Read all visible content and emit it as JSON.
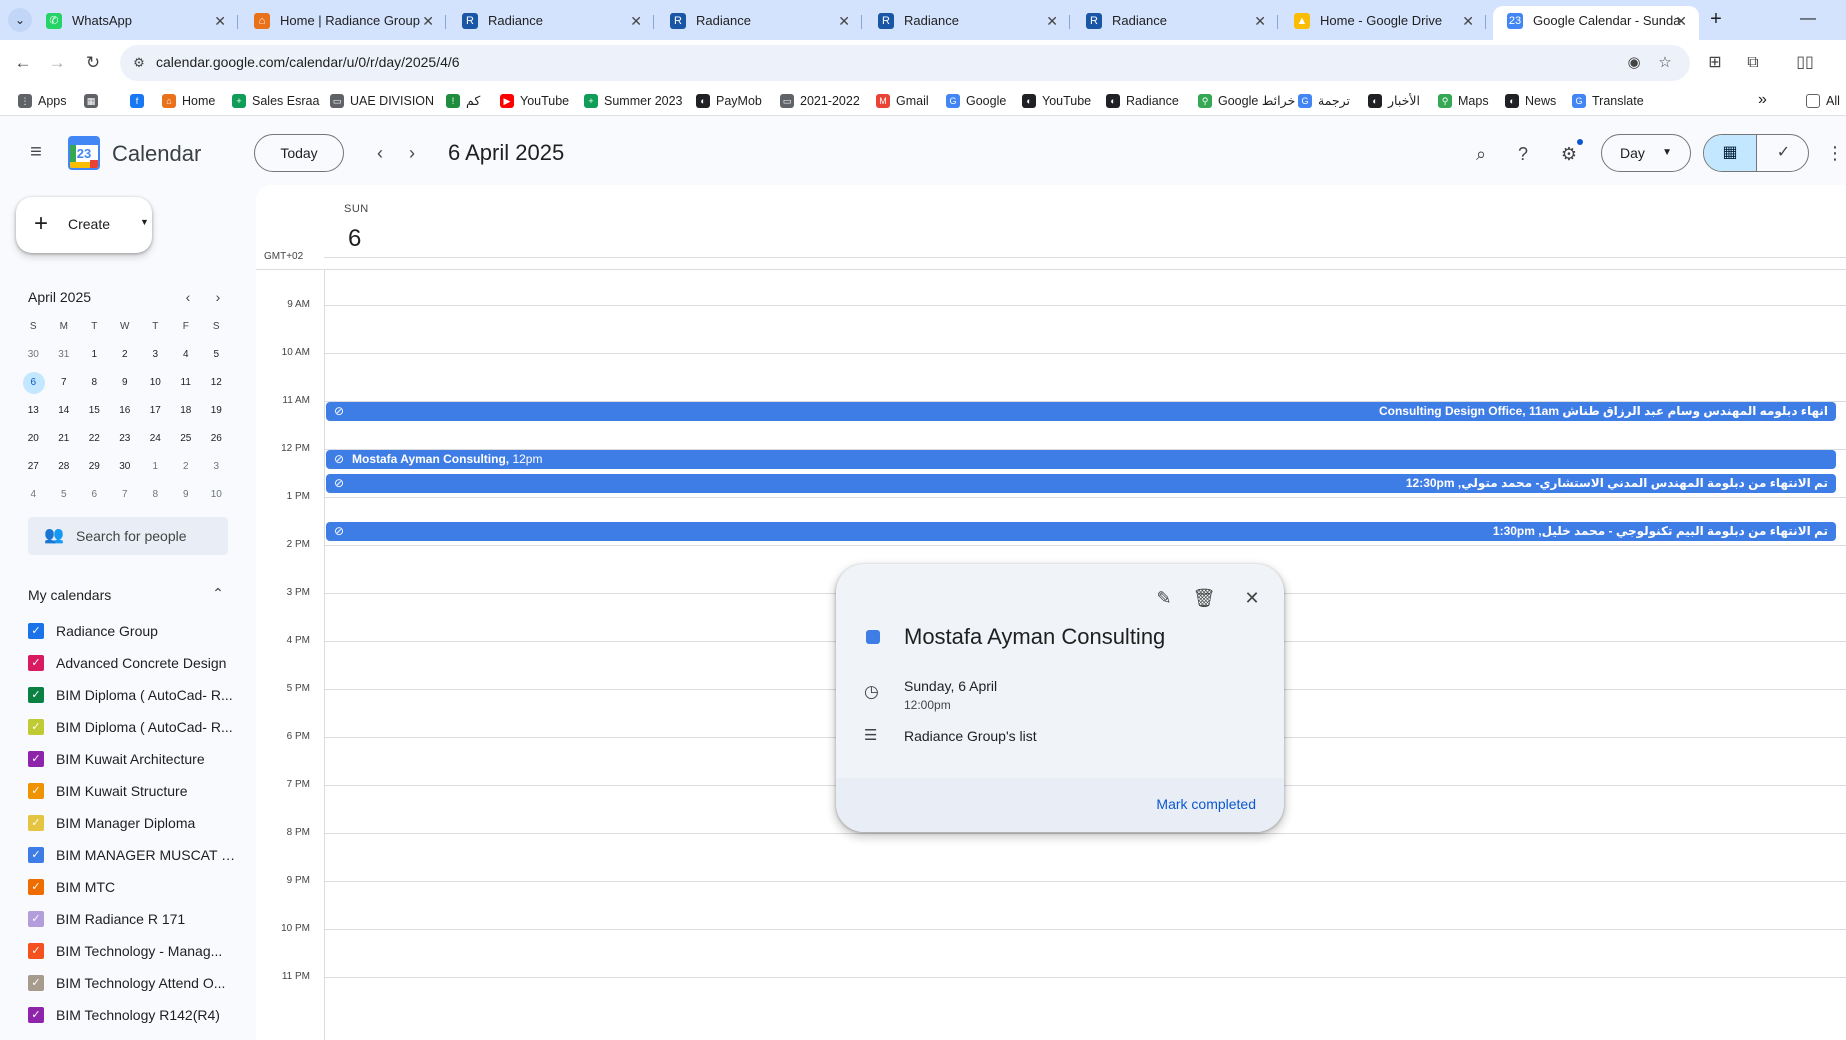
{
  "browser": {
    "tabs": [
      {
        "label": "WhatsApp",
        "fav_color": "#25d366",
        "fav": "✆"
      },
      {
        "label": "Home | Radiance Group",
        "fav_color": "#e8711a",
        "fav": "⌂"
      },
      {
        "label": "Radiance",
        "fav_color": "#1a56a6",
        "fav": "R"
      },
      {
        "label": "Radiance",
        "fav_color": "#1a56a6",
        "fav": "R"
      },
      {
        "label": "Radiance",
        "fav_color": "#1a56a6",
        "fav": "R"
      },
      {
        "label": "Radiance",
        "fav_color": "#1a56a6",
        "fav": "R"
      },
      {
        "label": "Home - Google Drive",
        "fav_color": "#fbbc04",
        "fav": "▲"
      },
      {
        "label": "Google Calendar - Sunda",
        "fav_color": "#4285f4",
        "fav": "23"
      }
    ],
    "url": "calendar.google.com/calendar/u/0/r/day/2025/4/6",
    "bookmarks": [
      {
        "label": "Apps",
        "color": "#5f6368",
        "icon": "⋮"
      },
      {
        "label": "",
        "color": "#5f6368",
        "icon": "▦"
      },
      {
        "label": "",
        "color": "#1877f2",
        "icon": "f"
      },
      {
        "label": "Home",
        "color": "#e8711a",
        "icon": "⌂"
      },
      {
        "label": "Sales Esraa",
        "color": "#0f9d58",
        "icon": "+"
      },
      {
        "label": "UAE DIVISION",
        "color": "#5f6368",
        "icon": "▭"
      },
      {
        "label": "كم",
        "color": "#1e8e3e",
        "icon": "!"
      },
      {
        "label": "YouTube",
        "color": "#ff0000",
        "icon": "▶"
      },
      {
        "label": "Summer 2023",
        "color": "#0f9d58",
        "icon": "+"
      },
      {
        "label": "PayMob",
        "color": "#202124",
        "icon": "◐"
      },
      {
        "label": "2021-2022",
        "color": "#5f6368",
        "icon": "▭"
      },
      {
        "label": "Gmail",
        "color": "#ea4335",
        "icon": "M"
      },
      {
        "label": "Google",
        "color": "#4285f4",
        "icon": "G"
      },
      {
        "label": "YouTube",
        "color": "#202124",
        "icon": "◐"
      },
      {
        "label": "Radiance",
        "color": "#202124",
        "icon": "◐"
      },
      {
        "label": "Google خرائط",
        "color": "#34a853",
        "icon": "⚲"
      },
      {
        "label": "ترجمة",
        "color": "#4285f4",
        "icon": "G"
      },
      {
        "label": "الأخبار",
        "color": "#202124",
        "icon": "◐"
      },
      {
        "label": "Maps",
        "color": "#34a853",
        "icon": "⚲"
      },
      {
        "label": "News",
        "color": "#202124",
        "icon": "◐"
      },
      {
        "label": "Translate",
        "color": "#4285f4",
        "icon": "G"
      }
    ],
    "bookmarks_more": "»",
    "all_bookmarks": "All"
  },
  "calendar": {
    "app_title": "Calendar",
    "logo_num": "23",
    "today_label": "Today",
    "date_title": "6 April 2025",
    "view_label": "Day",
    "create_label": "Create",
    "mini": {
      "title": "April 2025",
      "dow": [
        "S",
        "M",
        "T",
        "W",
        "T",
        "F",
        "S"
      ],
      "weeks": [
        [
          "30",
          "31",
          "1",
          "2",
          "3",
          "4",
          "5"
        ],
        [
          "6",
          "7",
          "8",
          "9",
          "10",
          "11",
          "12"
        ],
        [
          "13",
          "14",
          "15",
          "16",
          "17",
          "18",
          "19"
        ],
        [
          "20",
          "21",
          "22",
          "23",
          "24",
          "25",
          "26"
        ],
        [
          "27",
          "28",
          "29",
          "30",
          "1",
          "2",
          "3"
        ],
        [
          "4",
          "5",
          "6",
          "7",
          "8",
          "9",
          "10"
        ]
      ]
    },
    "people_search_placeholder": "Search for people",
    "my_calendars_title": "My calendars",
    "calendars": [
      {
        "label": "Radiance Group",
        "color": "#1a73e8"
      },
      {
        "label": "Advanced Concrete Design",
        "color": "#d81b60"
      },
      {
        "label": "BIM Diploma ( AutoCad- R...",
        "color": "#0b8043"
      },
      {
        "label": "BIM Diploma ( AutoCad- R...",
        "color": "#c0ca33"
      },
      {
        "label": "BIM Kuwait Architecture",
        "color": "#8e24aa"
      },
      {
        "label": "BIM Kuwait Structure",
        "color": "#f09300"
      },
      {
        "label": "BIM Manager Diploma",
        "color": "#e4c441"
      },
      {
        "label": "BIM MANAGER MUSCAT B...",
        "color": "#3f7de6"
      },
      {
        "label": "BIM MTC",
        "color": "#ef6c00"
      },
      {
        "label": "BIM Radiance R 171",
        "color": "#b39ddb"
      },
      {
        "label": "BIM Technology - Manag...",
        "color": "#f4511e"
      },
      {
        "label": "BIM Technology Attend O...",
        "color": "#a79b8e"
      },
      {
        "label": "BIM Technology R142(R4)",
        "color": "#8e24aa"
      }
    ],
    "day": {
      "dow": "SUN",
      "num": "6",
      "timezone": "GMT+02",
      "hours": [
        "9 AM",
        "10 AM",
        "11 AM",
        "12 PM",
        "1 PM",
        "2 PM",
        "3 PM",
        "4 PM",
        "5 PM",
        "6 PM",
        "7 PM",
        "8 PM",
        "9 PM",
        "10 PM",
        "11 PM"
      ],
      "events": [
        {
          "title": "انهاء دبلومه المهندس وسام عبد الرزاق طناش Consulting Design Office, 11am",
          "rtl": true,
          "start_hour": 11.0
        },
        {
          "title": "Mostafa Ayman Consulting,",
          "time": " 12pm",
          "rtl": false,
          "start_hour": 12.0
        },
        {
          "title": "تم الانتهاء من دبلومة المهندس المدني الاستشاري- محمد متولي, 12:30pm",
          "rtl": true,
          "start_hour": 12.5
        },
        {
          "title": "تم الانتهاء من دبلومة البيم تكنولوجي - محمد خليل, 1:30pm",
          "rtl": true,
          "start_hour": 13.5
        }
      ]
    },
    "popup": {
      "title": "Mostafa Ayman Consulting",
      "date": "Sunday, 6 April",
      "time": "12:00pm",
      "list": "Radiance Group's list",
      "mark_completed": "Mark completed"
    }
  }
}
